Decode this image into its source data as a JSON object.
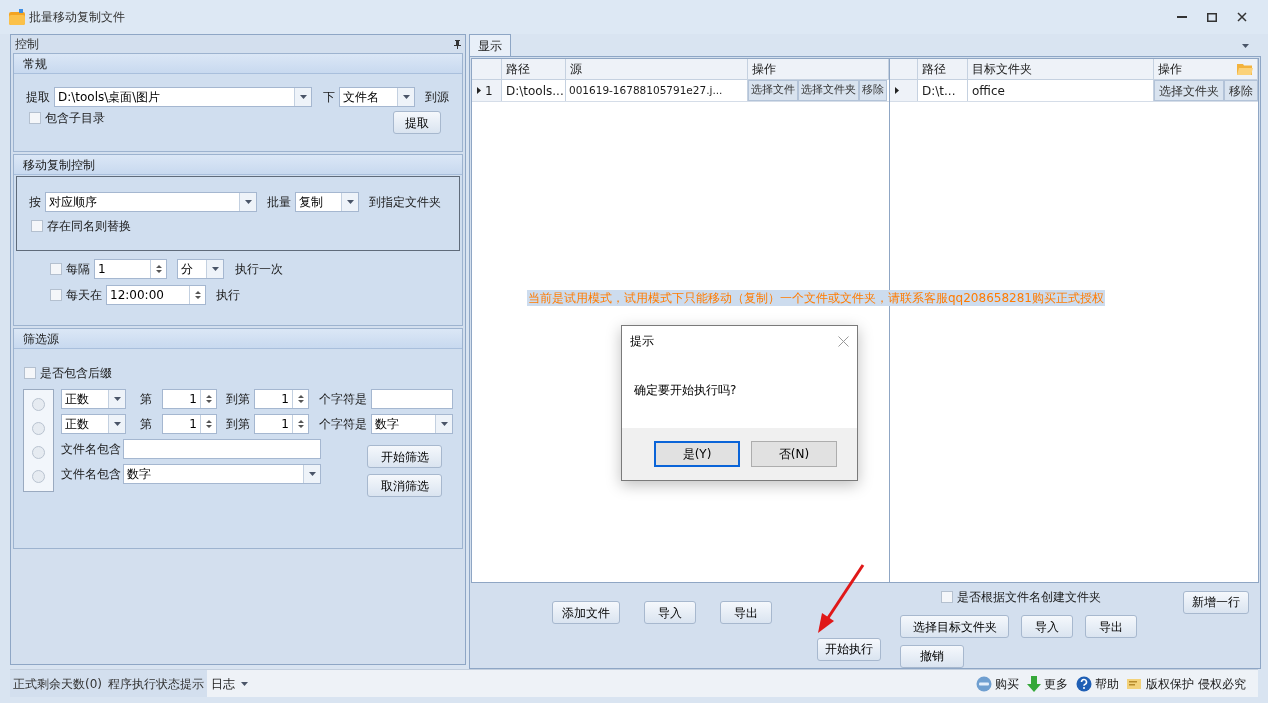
{
  "window": {
    "title": "批量移动复制文件"
  },
  "control_panel": {
    "title": "控制",
    "general": {
      "title": "常规",
      "extract_label": "提取",
      "path": "D:\\tools\\桌面\\图片",
      "under_label": "下",
      "name_mode": "文件名",
      "to_source_label": "到源",
      "include_subdirs": {
        "label": "包含子目录",
        "checked": false
      },
      "extract_button": "提取"
    },
    "move_copy": {
      "title": "移动复制控制",
      "by_label": "按",
      "order": "对应顺序",
      "batch_label": "批量",
      "batch_mode": "复制",
      "to_folder_label": "到指定文件夹",
      "replace_same": {
        "label": "存在同名则替换",
        "checked": false
      },
      "interval": {
        "checked": false,
        "label": "每隔",
        "value": "1",
        "unit": "分",
        "suffix": "执行一次"
      },
      "daily": {
        "checked": false,
        "label": "每天在",
        "value": "12:00:00",
        "suffix": "执行"
      }
    },
    "filter": {
      "title": "筛选源",
      "include_suffix": {
        "label": "是否包含后缀",
        "checked": false
      },
      "options": [
        {
          "kind": "range",
          "selected": false,
          "type": "正数",
          "from_label": "第",
          "from": "1",
          "to_label": "到第",
          "to": "1",
          "char_label": "个字符是",
          "field": {
            "kind": "text"
          }
        },
        {
          "kind": "range",
          "selected": false,
          "type": "正数",
          "from_label": "第",
          "from": "1",
          "to_label": "到第",
          "to": "1",
          "char_label": "个字符是",
          "field": {
            "kind": "combo",
            "value": "数字"
          }
        },
        {
          "kind": "contains",
          "selected": false,
          "label": "文件名包含",
          "field": {
            "kind": "text"
          }
        },
        {
          "kind": "contains",
          "selected": false,
          "label": "文件名包含",
          "field": {
            "kind": "combo",
            "value": "数字"
          }
        }
      ],
      "buttons": [
        "开始筛选",
        "取消筛选"
      ]
    }
  },
  "display": {
    "tab": {
      "label": "显示",
      "selected": true
    },
    "source_table": {
      "columns": [
        "路径",
        "源",
        "操作"
      ],
      "rows": [
        {
          "row_number": "1",
          "current": true,
          "path": "D:\\tools...",
          "source": "001619-16788105791e27.j...",
          "actions": [
            "选择文件",
            "选择文件夹",
            "移除"
          ]
        }
      ]
    },
    "target_table": {
      "columns": [
        "路径",
        "目标文件夹",
        "操作"
      ],
      "rows": [
        {
          "current": true,
          "path": "D:\\t...",
          "folder": "office",
          "actions": [
            "选择文件夹",
            "移除"
          ]
        }
      ]
    },
    "notice": "当前是试用模式，试用模式下只能移动（复制）一个文件或文件夹，请联系客服qq208658281购买正式授权",
    "source_buttons": [
      "添加文件",
      "导入",
      "导出"
    ],
    "start_button": "开始执行",
    "create_by_name": {
      "label": "是否根据文件名创建文件夹",
      "checked": false
    },
    "target_buttons": [
      "选择目标文件夹",
      "导入",
      "导出"
    ],
    "undo_button": "撤销",
    "add_row_button": "新增一行"
  },
  "status_bar": {
    "items": [
      "正式剩余天数(0)",
      "程序执行状态提示"
    ],
    "log_menu": "日志",
    "links": [
      {
        "kind": "buy",
        "label": "购买"
      },
      {
        "kind": "more",
        "label": "更多"
      },
      {
        "kind": "help",
        "label": "帮助"
      },
      {
        "kind": "copyright",
        "label": "版权保护 侵权必究"
      }
    ]
  },
  "dialog": {
    "title": "提示",
    "message": "确定要开始执行吗?",
    "buttons": [
      {
        "label": "是(Y)",
        "selected": true
      },
      {
        "label": "否(N)",
        "selected": false
      }
    ]
  }
}
